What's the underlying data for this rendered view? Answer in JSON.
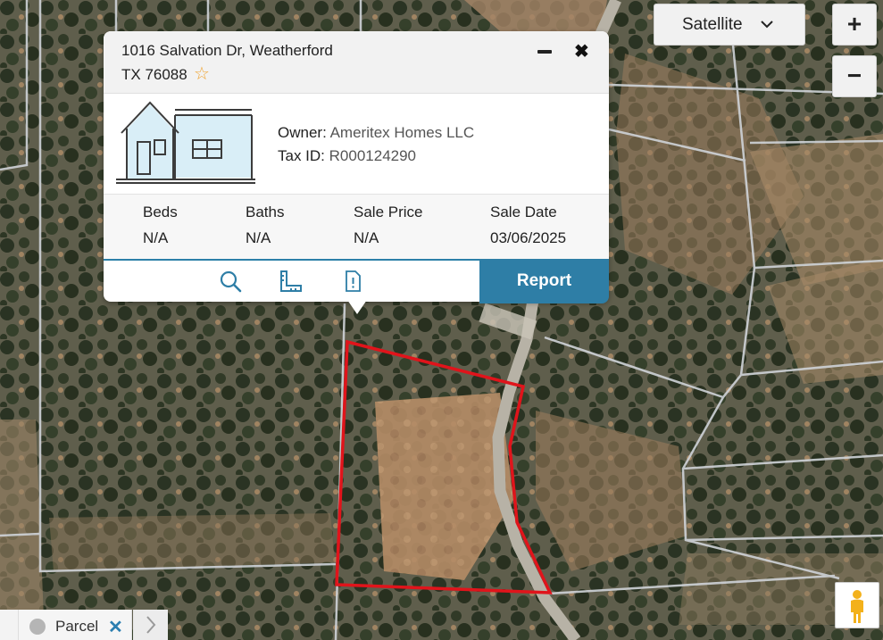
{
  "map": {
    "layer": "Satellite"
  },
  "popup": {
    "address_line1": "1016 Salvation Dr, Weatherford",
    "address_line2": "TX 76088",
    "favorite_icon": "star-outline-icon",
    "owner_label": "Owner:",
    "owner_value": "Ameritex Homes LLC",
    "taxid_label": "Tax ID:",
    "taxid_value": "R000124290",
    "stats": [
      {
        "label": "Beds",
        "value": "N/A"
      },
      {
        "label": "Baths",
        "value": "N/A"
      },
      {
        "label": "Sale Price",
        "value": "N/A"
      },
      {
        "label": "Sale Date",
        "value": "03/06/2025"
      }
    ],
    "actions": {
      "icons": [
        "search-icon",
        "ruler-icon",
        "document-alert-icon"
      ],
      "report_label": "Report"
    }
  },
  "controls": {
    "layer_selector": "Satellite",
    "zoom_in": "+",
    "zoom_out": "−"
  },
  "layer_tab": {
    "label": "Parcel",
    "close": "✕"
  },
  "colors": {
    "accent": "#2e7ea6",
    "parcel_outline": "#e0141b",
    "star": "#f0a430"
  }
}
